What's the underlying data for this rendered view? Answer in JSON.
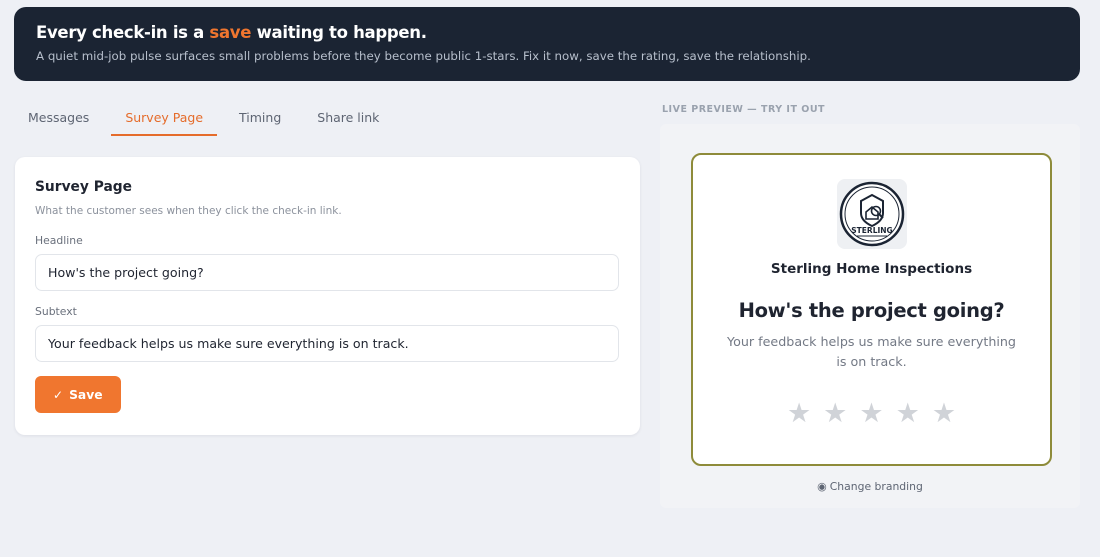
{
  "hero": {
    "title_pre": "Every check-in is a ",
    "title_accent": "save",
    "title_post": " waiting to happen.",
    "subtitle": "A quiet mid-job pulse surfaces small problems before they become public 1-stars. Fix it now, save the rating, save the relationship."
  },
  "tabs": [
    {
      "label": "Messages",
      "active": false
    },
    {
      "label": "Survey Page",
      "active": true
    },
    {
      "label": "Timing",
      "active": false
    },
    {
      "label": "Share link",
      "active": false
    }
  ],
  "editor": {
    "title": "Survey Page",
    "description": "What the customer sees when they click the check-in link.",
    "headline_label": "Headline",
    "headline_value": "How's the project going?",
    "subtext_label": "Subtext",
    "subtext_value": "Your feedback helps us make sure everything is on track.",
    "save_label": "Save"
  },
  "preview": {
    "label": "LIVE PREVIEW — TRY IT OUT",
    "brand_name": "Sterling Home Inspections",
    "logo_text": "STERLING",
    "headline": "How's the project going?",
    "subtext": "Your feedback helps us make sure everything is on track.",
    "rating": {
      "max": 5,
      "selected": 0
    },
    "change_branding": "Change branding"
  },
  "colors": {
    "accent": "#f0762f",
    "hero_bg": "#1b2433",
    "preview_border": "#8e8b3a",
    "star_empty": "#d0d3d8"
  }
}
